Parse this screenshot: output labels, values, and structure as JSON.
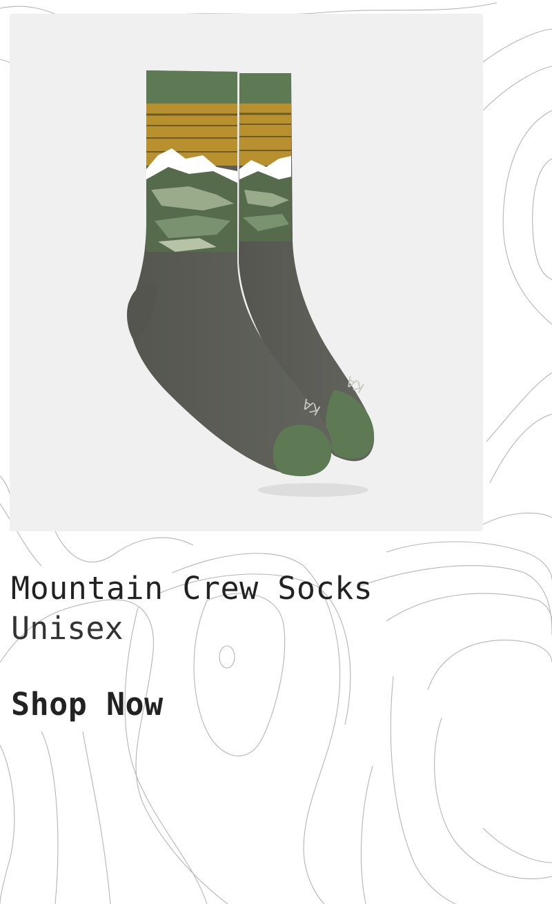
{
  "product": {
    "title": "Mountain Crew Socks",
    "subtitle": "Unisex",
    "image_icon": "mountain-crew-socks-image",
    "toe_brand_fragment_1": "KA",
    "toe_brand_fragment_2": "KA"
  },
  "cta": {
    "label": "Shop Now"
  },
  "colors": {
    "card_background": "#f0f0f0",
    "sock_green": "#5e7a55",
    "sock_mustard": "#b8902e",
    "sock_heather": "#5c5e58",
    "text": "#222222"
  }
}
